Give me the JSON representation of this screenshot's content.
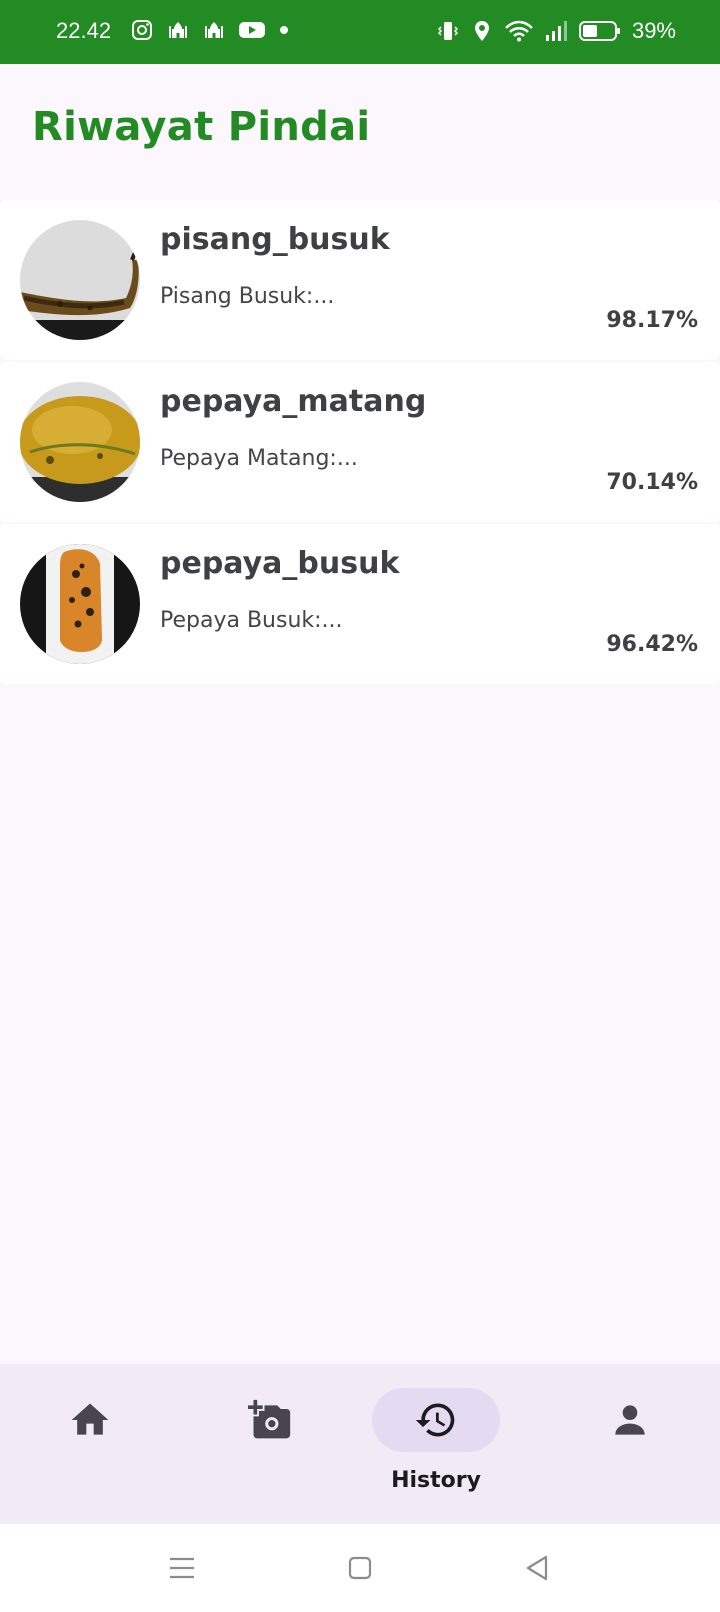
{
  "status_bar": {
    "time": "22.42",
    "battery": "39%",
    "left_icons": [
      "instagram-icon",
      "mosque-icon",
      "mosque-icon",
      "youtube-icon",
      "dot-icon"
    ],
    "right_icons": [
      "vibrate-icon",
      "location-icon",
      "wifi-icon",
      "signal-icon",
      "battery-icon"
    ]
  },
  "header": {
    "title": "Riwayat Pindai"
  },
  "history": [
    {
      "title": "pisang_busuk",
      "description": "Pisang Busuk:...",
      "score": "98.17%"
    },
    {
      "title": "pepaya_matang",
      "description": "Pepaya Matang:...",
      "score": "70.14%"
    },
    {
      "title": "pepaya_busuk",
      "description": "Pepaya Busuk:...",
      "score": "96.42%"
    }
  ],
  "bottom_nav": {
    "items": [
      {
        "icon": "home-icon",
        "label": ""
      },
      {
        "icon": "add-photo-icon",
        "label": ""
      },
      {
        "icon": "history-icon",
        "label": "History"
      },
      {
        "icon": "person-icon",
        "label": ""
      }
    ],
    "active_index": 2
  },
  "system_nav": [
    "menu-icon",
    "home-square-icon",
    "back-triangle-icon"
  ],
  "colors": {
    "brand_green": "#238b23",
    "background": "#fcf6fd",
    "nav_background": "#f2ebf6",
    "active_pill": "#e4dbf3"
  }
}
